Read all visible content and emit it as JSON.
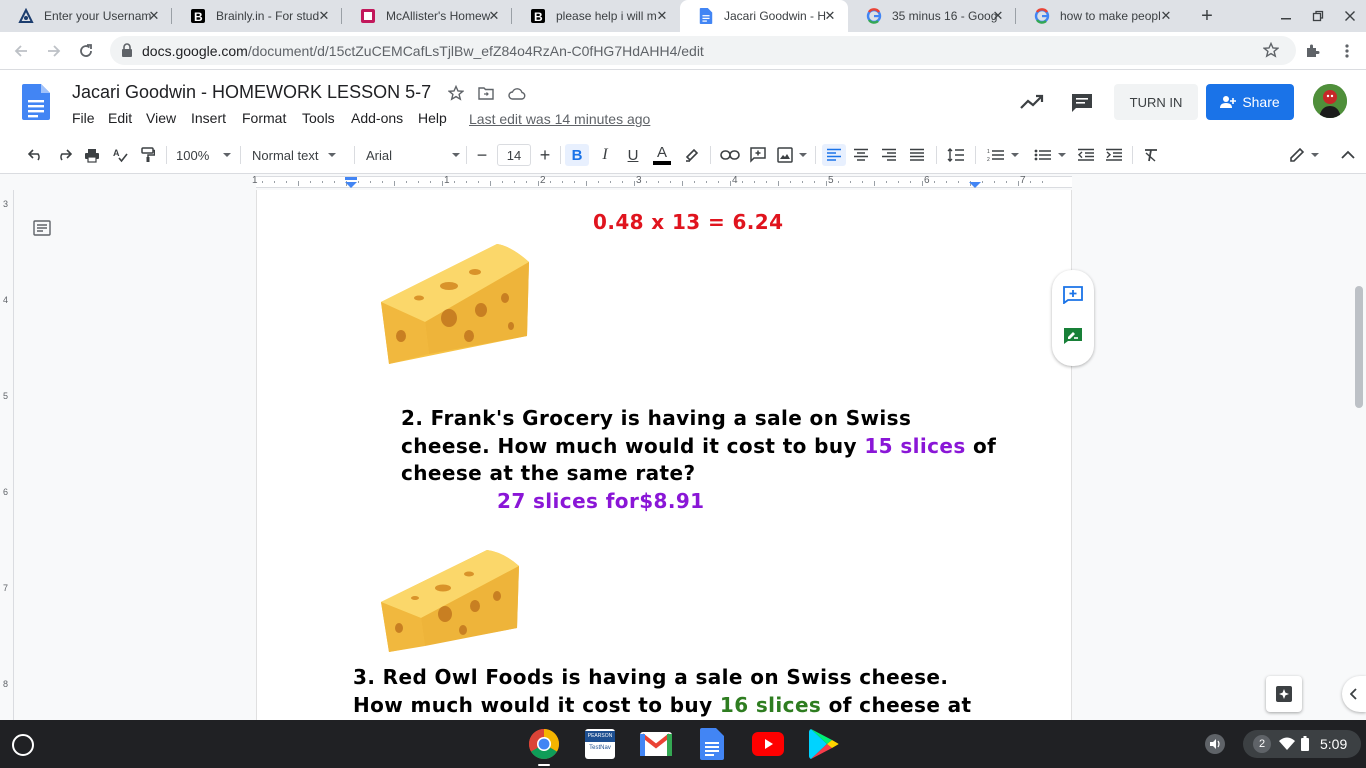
{
  "browser": {
    "tabs": [
      {
        "title": "Enter your Usernam",
        "favicon": "brainly-icon"
      },
      {
        "title": "Brainly.in - For stud",
        "favicon": "brainly-b-icon"
      },
      {
        "title": "McAllister's Homew",
        "favicon": "mcallister-icon"
      },
      {
        "title": "please help i will m",
        "favicon": "brainly-b-icon"
      },
      {
        "title": "Jacari Goodwin - H",
        "favicon": "google-docs-icon"
      },
      {
        "title": "35 minus 16 - Goog",
        "favicon": "google-icon"
      },
      {
        "title": "how to make peopl",
        "favicon": "google-icon"
      }
    ],
    "url_domain": "docs.google.com",
    "url_path": "/document/d/15ctZuCEMCafLsTjlBw_efZ84o4RzAn-C0fHG7HdAHH4/edit"
  },
  "docs": {
    "title": "Jacari Goodwin - HOMEWORK LESSON 5-7",
    "menu": [
      "File",
      "Edit",
      "View",
      "Insert",
      "Format",
      "Tools",
      "Add-ons",
      "Help"
    ],
    "last_edit": "Last edit was 14 minutes ago",
    "turn_in": "TURN IN",
    "share": "Share"
  },
  "toolbar": {
    "zoom": "100%",
    "style": "Normal text",
    "font": "Arial",
    "font_size": "14"
  },
  "ruler_numbers": [
    "1",
    "1",
    "2",
    "3",
    "4",
    "5",
    "6",
    "7"
  ],
  "vruler_numbers": [
    "3",
    "4",
    "5",
    "6",
    "7",
    "8"
  ],
  "document": {
    "line0": "0.48 x 13 = 6.24",
    "q2_line1": "2. Frank's Grocery is having a sale on Swiss",
    "q2_line2_a": "cheese. How much would it cost to buy ",
    "q2_line2_b": "15 slices",
    "q2_line2_c": " of",
    "q2_line3": "cheese at the same rate?",
    "q2_rate": "27 slices for$8.91",
    "q3_line1": "3. Red Owl Foods is having a sale on Swiss cheese.",
    "q3_line2_a": "How much would it cost to buy ",
    "q3_line2_b": "16 slices",
    "q3_line2_c": " of cheese at"
  },
  "taskbar": {
    "clock": "5:09",
    "notification_count": "2",
    "apps": [
      "chrome-icon",
      "pearson-testnav-icon",
      "gmail-icon",
      "google-docs-icon",
      "youtube-icon",
      "play-store-icon"
    ],
    "testnav_label_top": "PEARSON",
    "testnav_label_bottom": "TestNav"
  },
  "colors": {
    "red_text": "#e0141e",
    "purple_text": "#8a16d7",
    "green_text": "#2e7d20",
    "share_blue": "#1a73e8"
  }
}
